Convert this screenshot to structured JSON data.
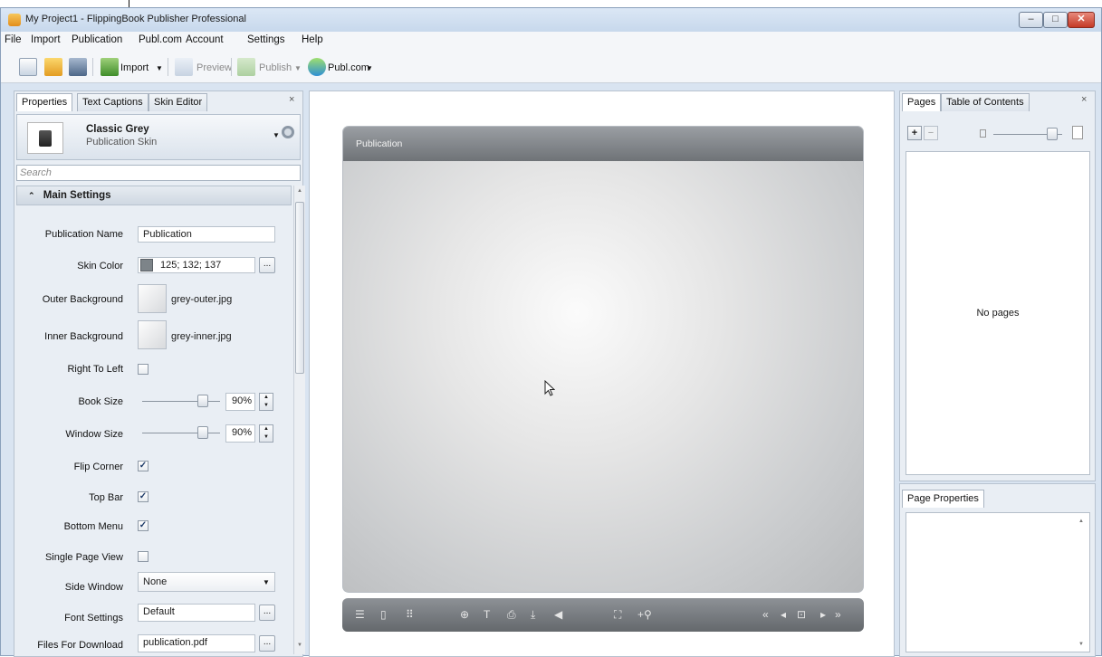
{
  "window": {
    "title": "My Project1 - FlippingBook Publisher Professional",
    "controls": {
      "minimize": "–",
      "maximize": "□",
      "close": "✕"
    }
  },
  "menu": [
    "File",
    "Import",
    "Publication",
    "Publ.com",
    "Account",
    "Settings",
    "Help"
  ],
  "toolbar": {
    "import_label": "Import",
    "preview_label": "Preview",
    "publish_label": "Publish",
    "publcom_label": "Publ.com",
    "dropdown_glyph": "▼"
  },
  "left_panel": {
    "tabs": [
      "Properties",
      "Text Captions",
      "Skin Editor"
    ],
    "close": "×",
    "skin": {
      "name": "Classic Grey",
      "subtitle": "Publication Skin"
    },
    "search_placeholder": "Search",
    "section_title": "Main Settings",
    "settings": {
      "publication_name": {
        "label": "Publication Name",
        "value": "Publication"
      },
      "skin_color": {
        "label": "Skin Color",
        "value": "125; 132; 137",
        "swatch": "#7d8489"
      },
      "outer_background": {
        "label": "Outer Background",
        "value": "grey-outer.jpg"
      },
      "inner_background": {
        "label": "Inner Background",
        "value": "grey-inner.jpg"
      },
      "right_to_left": {
        "label": "Right To Left",
        "checked": false
      },
      "book_size": {
        "label": "Book Size",
        "value": "90%",
        "level": 0.9
      },
      "window_size": {
        "label": "Window Size",
        "value": "90%",
        "level": 0.9
      },
      "flip_corner": {
        "label": "Flip Corner",
        "checked": true
      },
      "top_bar": {
        "label": "Top Bar",
        "checked": true
      },
      "bottom_menu": {
        "label": "Bottom Menu",
        "checked": true
      },
      "single_page_view": {
        "label": "Single Page View",
        "checked": false
      },
      "side_window": {
        "label": "Side Window",
        "value": "None"
      },
      "font_settings": {
        "label": "Font Settings",
        "value": "Default"
      },
      "files_for_download": {
        "label": "Files For Download",
        "value": "publication.pdf"
      }
    },
    "dots": "...",
    "checkmark": "✓"
  },
  "preview": {
    "book_title": "Publication"
  },
  "right_panel": {
    "tabs": [
      "Pages",
      "Table of Contents"
    ],
    "close": "×",
    "empty_text": "No pages",
    "page_properties_tab": "Page Properties"
  },
  "colors": {
    "accent": "#4a7fb8",
    "panel": "#e9eef4"
  }
}
